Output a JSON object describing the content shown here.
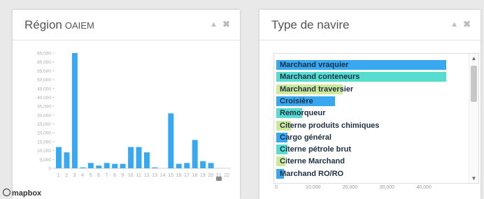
{
  "region_panel": {
    "title": "Région",
    "subtitle": "OAIEM",
    "collapse_icon": "chevron-up-icon",
    "close_icon": "close-icon"
  },
  "vessel_panel": {
    "title": "Type de navire",
    "collapse_icon": "chevron-up-icon",
    "close_icon": "close-icon"
  },
  "attribution": "mapbox",
  "colors": {
    "blue": "#38a8f0",
    "teal": "#57dcd0",
    "lime": "#cfe99a"
  },
  "chart_data": [
    {
      "type": "bar",
      "categories": [
        "1",
        "2",
        "3",
        "4",
        "5",
        "6",
        "7",
        "8",
        "9",
        "10",
        "11",
        "12",
        "13",
        "14",
        "15",
        "16",
        "17",
        "18",
        "19",
        "20",
        "21",
        "22"
      ],
      "values": [
        12000,
        9000,
        65000,
        500,
        3000,
        1500,
        3000,
        2500,
        2500,
        12000,
        12000,
        9000,
        500,
        0,
        31000,
        2500,
        3000,
        16000,
        4000,
        3000,
        0,
        0
      ],
      "ylim": [
        0,
        65000
      ],
      "yticks": [
        "0",
        "5,000",
        "10,000",
        "15,000",
        "20,000",
        "25,000",
        "30,000",
        "35,000",
        "40,000",
        "45,000",
        "50,000",
        "55,000",
        "60,000",
        "65,000"
      ],
      "xticks": [
        "1",
        "2",
        "3",
        "4",
        "5",
        "6",
        "7",
        "8",
        "9",
        "10",
        "11",
        "12",
        "13",
        "14",
        "15",
        "16",
        "17",
        "18",
        "19",
        "20",
        "21",
        "22"
      ],
      "color": "#38a8f0"
    },
    {
      "type": "bar",
      "orientation": "horizontal",
      "categories": [
        "Marchand vraquier",
        "Marchand conteneurs",
        "Marchand traversier",
        "Croisière",
        "Remorqueur",
        "Citerne produits chimiques",
        "Cargo général",
        "Citerne pétrole brut",
        "Citerne Marchand",
        "Marchand RO/RO"
      ],
      "values": [
        46000,
        46000,
        18000,
        16000,
        7000,
        4000,
        3000,
        3000,
        2500,
        2000
      ],
      "bar_colors": [
        "#38a8f0",
        "#57dcd0",
        "#cfe99a",
        "#38a8f0",
        "#57dcd0",
        "#cfe99a",
        "#38a8f0",
        "#57dcd0",
        "#cfe99a",
        "#38a8f0"
      ],
      "xlim": [
        0,
        47000
      ],
      "xticks": [
        "0",
        "10,000",
        "20,000",
        "30,000",
        "40,000"
      ]
    }
  ]
}
